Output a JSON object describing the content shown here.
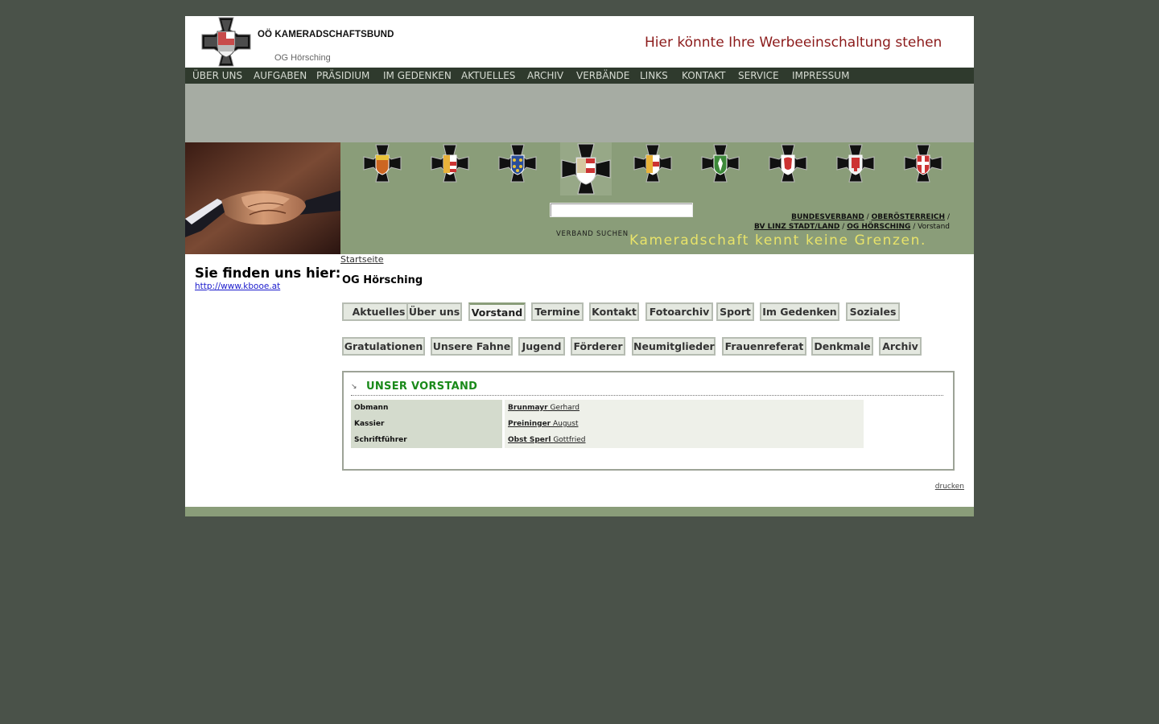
{
  "header": {
    "org_name": "OÖ KAMERADSCHAFTSBUND",
    "org_sub": "OG Hörsching",
    "ad_text": "Hier könnte Ihre Werbeeinschaltung stehen"
  },
  "nav": [
    "ÜBER UNS",
    "AUFGABEN",
    "PRÄSIDIUM",
    "IM GEDENKEN",
    "AKTUELLES",
    "ARCHIV",
    "VERBÄNDE",
    "LINKS",
    "KONTAKT",
    "SERVICE",
    "IMPRESSUM"
  ],
  "banner": {
    "search_label": "VERBAND SUCHEN",
    "search_value": "",
    "breadcrumb": {
      "bundesverband": "BUNDESVERBAND",
      "oberoesterreich": "OBERÖSTERREICH",
      "bv_linz": "BV LINZ STADT/LAND",
      "og": "OG HÖRSCHING",
      "current": "Vorstand",
      "sep": "/"
    },
    "slogan": "Kameradschaft kennt keine Grenzen."
  },
  "left": {
    "find_us": "Sie finden uns hier:",
    "link": "http://www.kbooe.at"
  },
  "startseite": "Startseite",
  "og_title": "OG Hörsching",
  "tabs_row1": [
    "Aktuelles",
    "Über uns",
    "Vorstand",
    "Termine",
    "Kontakt",
    "Fotoarchiv",
    "Sport",
    "Im Gedenken",
    "Soziales"
  ],
  "tabs_row2": [
    "Gratulationen",
    "Unsere Fahne",
    "Jugend",
    "Förderer",
    "Neumitglieder",
    "Frauenreferat",
    "Denkmale",
    "Archiv"
  ],
  "active_tab": "Vorstand",
  "box": {
    "title": "UNSER VORSTAND",
    "rows": [
      {
        "role": "Obmann",
        "surname": "Brunmayr",
        "firstname": "Gerhard"
      },
      {
        "role": "Kassier",
        "surname": "Preininger",
        "firstname": "August"
      },
      {
        "role": "Schriftführer",
        "surname": "Obst Sperl",
        "firstname": "Gottfried"
      }
    ]
  },
  "drucken": "drucken",
  "colors": {
    "background": "#4a5249",
    "nav": "#2f3a2d",
    "banner": "#8a9d79",
    "ad_text": "#8b1a1a",
    "slogan": "#e8e36a",
    "box_title": "#1a8a1a"
  },
  "crosses": [
    "burgenland-cross-icon",
    "carinthia-cross-icon",
    "lower-austria-cross-icon",
    "upper-austria-cross-icon",
    "salzburg-cross-icon",
    "styria-cross-icon",
    "tyrol-cross-icon",
    "vorarlberg-cross-icon",
    "vienna-cross-icon"
  ]
}
